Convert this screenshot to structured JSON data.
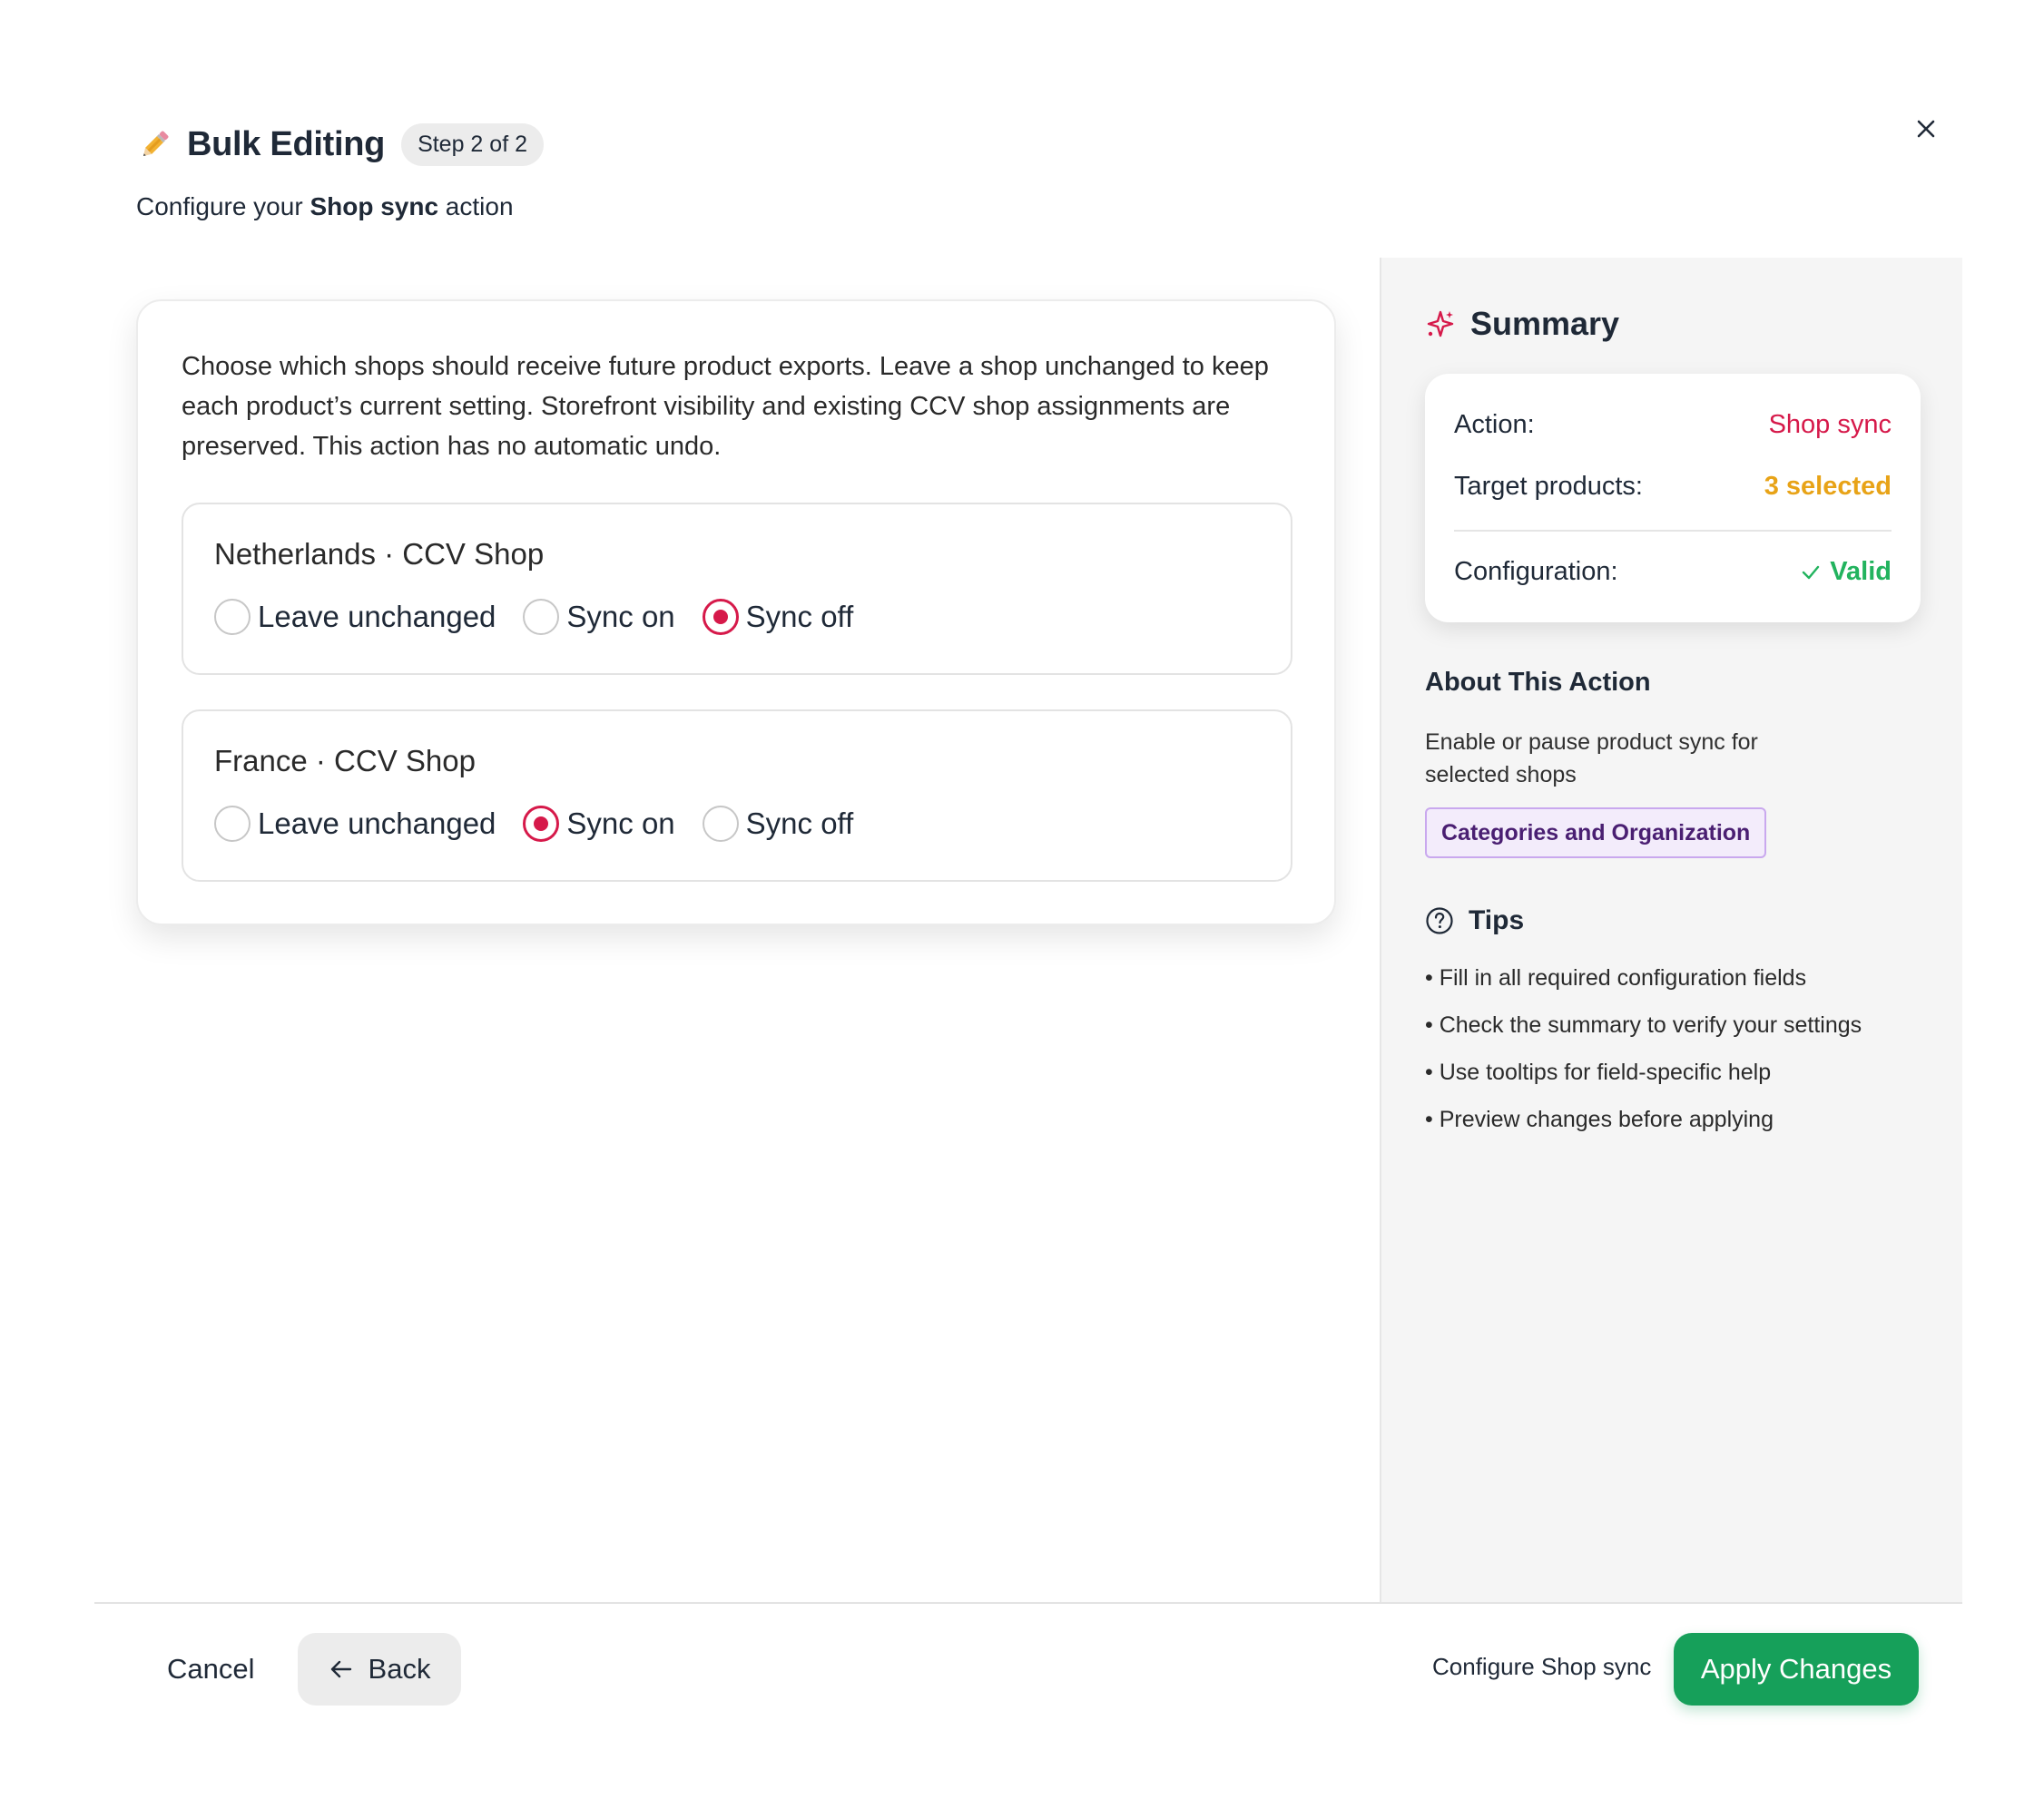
{
  "header": {
    "icon": "pencil-icon",
    "title": "Bulk Editing",
    "step": "Step 2 of 2",
    "subtitle_prefix": "Configure your ",
    "subtitle_action": "Shop sync",
    "subtitle_suffix": " action",
    "close_icon": "close-icon"
  },
  "main": {
    "description": "Choose which shops should receive future product exports. Leave a shop unchanged to keep each product’s current setting. Storefront visibility and existing CCV shop assignments are preserved. This action has no automatic undo.",
    "shops": [
      {
        "name": "Netherlands · CCV Shop",
        "options": [
          "Leave unchanged",
          "Sync on",
          "Sync off"
        ],
        "selected": "Sync off"
      },
      {
        "name": "France · CCV Shop",
        "options": [
          "Leave unchanged",
          "Sync on",
          "Sync off"
        ],
        "selected": "Sync on"
      }
    ]
  },
  "summary": {
    "title": "Summary",
    "icon": "sparkle-icon",
    "action_label": "Action:",
    "action_value": "Shop sync",
    "target_label": "Target products:",
    "target_value": "3 selected",
    "config_label": "Configuration:",
    "config_value": "Valid",
    "colors": {
      "action": "#d6194a",
      "target": "#e8a317",
      "valid": "#22b35e"
    }
  },
  "about": {
    "title": "About This Action",
    "description": "Enable or pause product sync for selected shops",
    "category": "Categories and Organization"
  },
  "tips": {
    "title": "Tips",
    "icon": "question-circle-icon",
    "items": [
      "• Fill in all required configuration fields",
      "• Check the summary to verify your settings",
      "• Use tooltips for field-specific help",
      "• Preview changes before applying"
    ]
  },
  "footer": {
    "cancel": "Cancel",
    "back": "Back",
    "configure_note": "Configure Shop sync",
    "apply": "Apply Changes",
    "apply_color": "#16a05a"
  }
}
